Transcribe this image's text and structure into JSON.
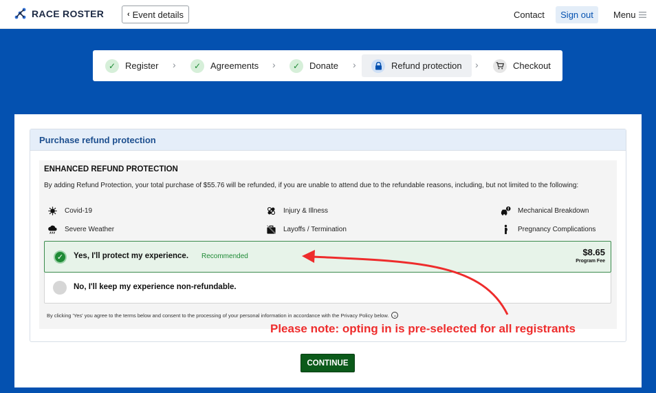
{
  "header": {
    "logo_text": "RACE ROSTER",
    "event_details_label": "Event details",
    "nav": {
      "contact": "Contact",
      "sign_out": "Sign out",
      "menu": "Menu"
    }
  },
  "stepper": {
    "steps": [
      {
        "label": "Register",
        "state": "done",
        "icon": "check-icon"
      },
      {
        "label": "Agreements",
        "state": "done",
        "icon": "check-icon"
      },
      {
        "label": "Donate",
        "state": "done",
        "icon": "check-icon"
      },
      {
        "label": "Refund protection",
        "state": "current",
        "icon": "lock-icon"
      },
      {
        "label": "Checkout",
        "state": "todo",
        "icon": "cart-icon"
      }
    ]
  },
  "panel": {
    "header": "Purchase refund protection",
    "title": "ENHANCED REFUND PROTECTION",
    "description": "By adding Refund Protection, your total purchase of $55.76 will be refunded, if you are unable to attend due to the refundable reasons, including, but not limited to the following:",
    "reasons": [
      {
        "label": "Covid-19",
        "icon": "virus-icon"
      },
      {
        "label": "Injury & Illness",
        "icon": "bandage-icon"
      },
      {
        "label": "Mechanical Breakdown",
        "icon": "car-breakdown-icon"
      },
      {
        "label": "Severe Weather",
        "icon": "storm-icon"
      },
      {
        "label": "Layoffs / Termination",
        "icon": "briefcase-x-icon"
      },
      {
        "label": "Pregnancy Complications",
        "icon": "pregnant-person-icon"
      }
    ],
    "option_yes": {
      "label": "Yes, I'll protect my experience.",
      "badge": "Recommended",
      "price": "$8.65",
      "price_sub": "Program Fee",
      "selected": true
    },
    "option_no": {
      "label": "No, I'll keep my experience non-refundable.",
      "selected": false
    },
    "terms": "By clicking 'Yes' you agree to the terms below and consent to the processing of your personal information in accordance with the Privacy Policy below."
  },
  "annotation": {
    "note": "Please note: opting in is pre-selected for all registrants",
    "color": "#ee2c2c"
  },
  "continue_label": "CONTINUE",
  "colors": {
    "brand_blue": "#0451b0",
    "success_green": "#1e8a35",
    "continue_green": "#0b5a1a"
  }
}
